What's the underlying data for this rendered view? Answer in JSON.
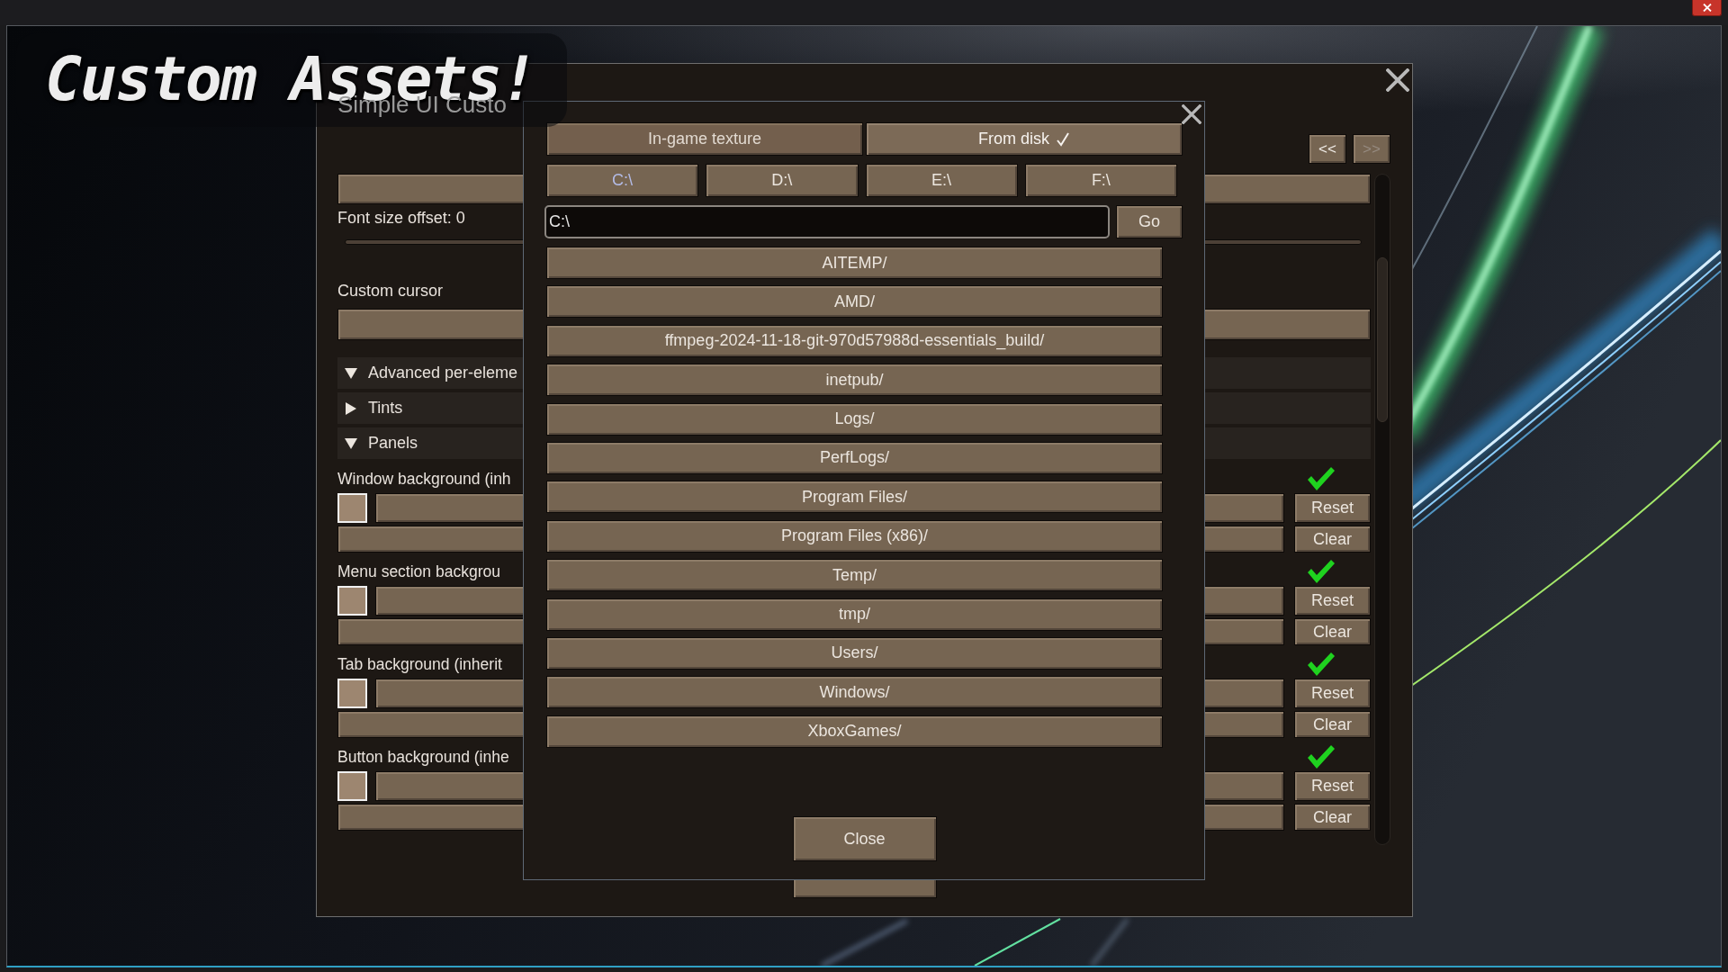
{
  "caption": "Custom Assets!",
  "settings_window": {
    "title": "Simple UI Custo",
    "nav_buttons": [
      {
        "label": "<<",
        "disabled": false
      },
      {
        "label": ">>",
        "disabled": true
      }
    ],
    "font_size_label": "Font size offset: 0",
    "cursor_label": "Custom cursor",
    "sections": [
      {
        "label": "Advanced per-eleme",
        "expanded": true
      },
      {
        "label": "Tints",
        "expanded": false
      },
      {
        "label": "Panels",
        "expanded": true
      }
    ],
    "entries": [
      {
        "label": "Window background (inh",
        "applied": true,
        "reset": "Reset",
        "clear": "Clear"
      },
      {
        "label": "Menu section backgrou",
        "applied": true,
        "reset": "Reset",
        "clear": "Clear"
      },
      {
        "label": "Tab background (inherit",
        "applied": true,
        "reset": "Reset",
        "clear": "Clear"
      },
      {
        "label": "Button background (inhe",
        "applied": true,
        "reset": "Reset",
        "clear": "Clear"
      }
    ]
  },
  "file_dialog": {
    "source_tabs": [
      {
        "label": "In-game texture",
        "selected": false
      },
      {
        "label": "From disk",
        "selected": true
      }
    ],
    "drives": [
      {
        "label": "C:\\",
        "selected": true
      },
      {
        "label": "D:\\",
        "selected": false
      },
      {
        "label": "E:\\",
        "selected": false
      },
      {
        "label": "F:\\",
        "selected": false
      }
    ],
    "path": {
      "value": "C:\\"
    },
    "go": "Go",
    "folders": [
      "AITEMP/",
      "AMD/",
      "ffmpeg-2024-11-18-git-970d57988d-essentials_build/",
      "inetpub/",
      "Logs/",
      "PerfLogs/",
      "Program Files/",
      "Program Files (x86)/",
      "Temp/",
      "tmp/",
      "Users/",
      "Windows/",
      "XboxGames/"
    ],
    "close": "Close"
  }
}
